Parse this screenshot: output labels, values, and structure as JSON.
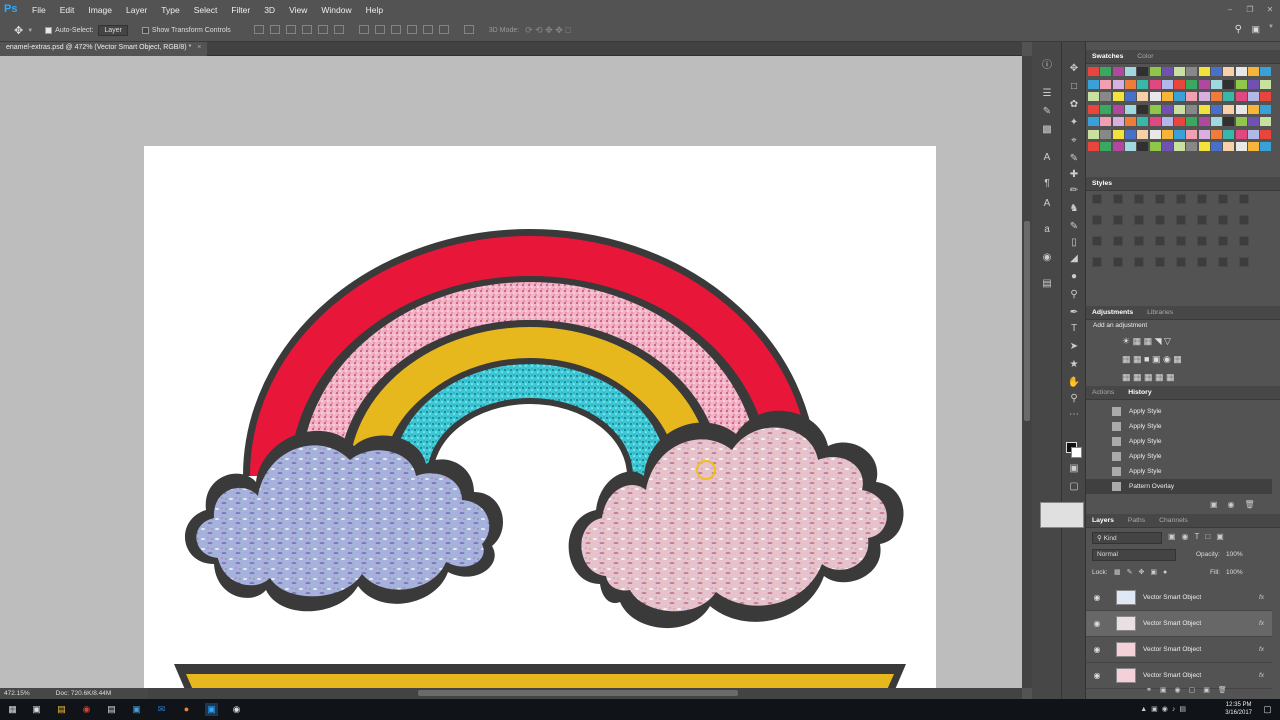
{
  "app": {
    "logo": "Ps"
  },
  "menu": [
    "File",
    "Edit",
    "Image",
    "Layer",
    "Type",
    "Select",
    "Filter",
    "3D",
    "View",
    "Window",
    "Help"
  ],
  "options_bar": {
    "auto_select_label": "Auto-Select:",
    "auto_select_value": "Layer",
    "show_transform_label": "Show Transform Controls",
    "mode_3d_label": "3D Mode:"
  },
  "document": {
    "tab_title": "enamel-extras.psd @ 472% (Vector Smart Object, RGB/8) *"
  },
  "status": {
    "zoom": "472.15%",
    "doc_size": "Doc: 720.6K/8.44M"
  },
  "panels": {
    "swatches_tabs": [
      "Swatches",
      "Color"
    ],
    "styles_title": "Styles",
    "adjustments_tabs": [
      "Adjustments",
      "Libraries"
    ],
    "add_adjustment": "Add an adjustment",
    "history_tabs": [
      "Actions",
      "History"
    ],
    "history_items": [
      "Apply Style",
      "Apply Style",
      "Apply Style",
      "Apply Style",
      "Apply Style",
      "Pattern Overlay"
    ],
    "layers_tabs": [
      "Layers",
      "Paths",
      "Channels"
    ],
    "kind_filter": "Kind",
    "blend_mode": "Normal",
    "opacity_label": "Opacity:",
    "opacity_value": "100%",
    "lock_label": "Lock:",
    "fill_label": "Fill:",
    "fill_value": "100%",
    "layers": [
      "Vector Smart Object",
      "Vector Smart Object",
      "Vector Smart Object",
      "Vector Smart Object"
    ],
    "fx_label": "fx"
  },
  "taskbar": {
    "time": "12:35 PM",
    "date": "3/16/2017"
  },
  "colors": {
    "rainbow_red": "#e8173a",
    "rainbow_pink": "#f0a8c0",
    "rainbow_yellow": "#e6b81e",
    "rainbow_cyan": "#3cc8d4",
    "outline": "#3a3a3a",
    "cloud_left": "#aab6dc",
    "cloud_right": "#e8c8d0"
  }
}
